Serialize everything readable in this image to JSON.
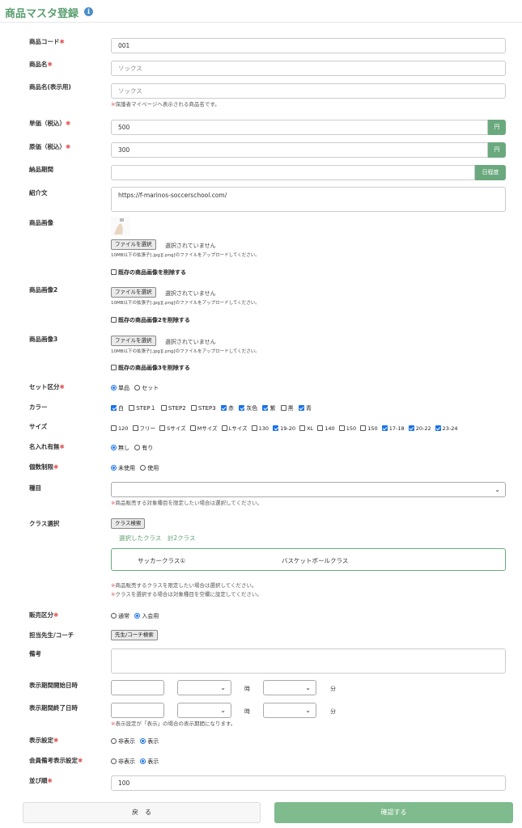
{
  "page": {
    "title": "商品マスタ登録",
    "info_icon": "info-icon"
  },
  "required_mark": "✱",
  "yen": "円",
  "fields": {
    "code": {
      "label": "商品コード",
      "value": "001"
    },
    "name": {
      "label": "商品名",
      "placeholder": "ソックス"
    },
    "display_name": {
      "label": "商品名(表示用)",
      "placeholder": "ソックス",
      "note": "保護者マイページへ表示される商品名です。"
    },
    "price_incl": {
      "label": "単価（税込）",
      "value": "500"
    },
    "cost_incl": {
      "label": "原価（税込）",
      "value": "300"
    },
    "delivery": {
      "label": "納品期間",
      "addon": "日程度"
    },
    "intro": {
      "label": "紹介文",
      "value": "https://f-marinos-soccerschool.com/"
    },
    "image1": {
      "label": "商品画像",
      "button": "ファイルを選択",
      "no_file": "選択されていません",
      "hint": "10MB以下の拡張子[.jpg][.png]のファイルをアップロードしてください。",
      "delete_label": "既存の商品画像を削除する"
    },
    "image2": {
      "label": "商品画像2",
      "button": "ファイルを選択",
      "no_file": "選択されていません",
      "hint": "10MB以下の拡張子[.jpg][.png]のファイルをアップロードしてください。",
      "delete_label": "既存の商品画像2を削除する"
    },
    "image3": {
      "label": "商品画像3",
      "button": "ファイルを選択",
      "no_file": "選択されていません",
      "hint": "10MB以下の拡張子[.jpg][.png]のファイルをアップロードしてください。",
      "delete_label": "既存の商品画像3を削除する"
    },
    "set_type": {
      "label": "セット区分",
      "options": [
        {
          "label": "単品",
          "checked": true
        },
        {
          "label": "セット",
          "checked": false
        }
      ]
    },
    "color": {
      "label": "カラー",
      "options": [
        {
          "label": "白",
          "checked": true
        },
        {
          "label": "STEP１",
          "checked": false
        },
        {
          "label": "STEP2",
          "checked": false
        },
        {
          "label": "STEP3",
          "checked": false
        },
        {
          "label": "赤",
          "checked": true
        },
        {
          "label": "灰色",
          "checked": true
        },
        {
          "label": "紫",
          "checked": true
        },
        {
          "label": "黒",
          "checked": false
        },
        {
          "label": "青",
          "checked": true
        }
      ]
    },
    "size": {
      "label": "サイズ",
      "options": [
        {
          "label": "120",
          "checked": false
        },
        {
          "label": "フリー",
          "checked": false
        },
        {
          "label": "Sサイズ",
          "checked": false
        },
        {
          "label": "Mサイズ",
          "checked": false
        },
        {
          "label": "Lサイズ",
          "checked": false
        },
        {
          "label": "130",
          "checked": false
        },
        {
          "label": "19-20",
          "checked": true
        },
        {
          "label": "XL",
          "checked": false
        },
        {
          "label": "140",
          "checked": false
        },
        {
          "label": "150",
          "checked": false
        },
        {
          "label": "150",
          "checked": false
        },
        {
          "label": "17-18",
          "checked": true
        },
        {
          "label": "20-22",
          "checked": true
        },
        {
          "label": "23-24",
          "checked": true
        }
      ]
    },
    "name_print": {
      "label": "名入れ有無",
      "options": [
        {
          "label": "無し",
          "checked": true
        },
        {
          "label": "有り",
          "checked": false
        }
      ]
    },
    "qty_limit": {
      "label": "個数制限",
      "options": [
        {
          "label": "未使用",
          "checked": true
        },
        {
          "label": "使用",
          "checked": false
        }
      ]
    },
    "category": {
      "label": "種目",
      "note": "商品販売する対象種目を限定したい場合は選択してください。"
    },
    "class_select": {
      "label": "クラス選択",
      "button": "クラス検索",
      "selected_text": "選択したクラス　計2クラス",
      "classes": [
        "サッカークラス①",
        "バスケットボールクラス"
      ],
      "note1": "商品販売するクラスを限定したい場合は選択してください。",
      "note2": "クラスを選択する場合は対象種目を空欄に設定してください。"
    },
    "sale_type": {
      "label": "販売区分",
      "options": [
        {
          "label": "通常",
          "checked": false
        },
        {
          "label": "入会用",
          "checked": true
        }
      ]
    },
    "coach": {
      "label": "担当先生/コーチ",
      "button": "先生/コーチ検索"
    },
    "remarks": {
      "label": "備考"
    },
    "display_start": {
      "label": "表示期間開始日時",
      "hour_unit": "時",
      "min_unit": "分"
    },
    "display_end": {
      "label": "表示期間終了日時",
      "hour_unit": "時",
      "min_unit": "分",
      "note": "表示設定が「表示」の場合の表示期間になります。"
    },
    "display_setting": {
      "label": "表示設定",
      "options": [
        {
          "label": "非表示",
          "checked": false
        },
        {
          "label": "表示",
          "checked": true
        }
      ]
    },
    "member_remarks": {
      "label": "会員備考表示設定",
      "options": [
        {
          "label": "非表示",
          "checked": false
        },
        {
          "label": "表示",
          "checked": true
        }
      ]
    },
    "sort_order": {
      "label": "並び順",
      "value": "100"
    }
  },
  "footer": {
    "back": "戻　る",
    "confirm": "確認する"
  },
  "colors": {
    "accent": "#5a9e6f",
    "button_green": "#7fbb8d",
    "required": "#e05a5a",
    "check_blue": "#1a73e8"
  }
}
